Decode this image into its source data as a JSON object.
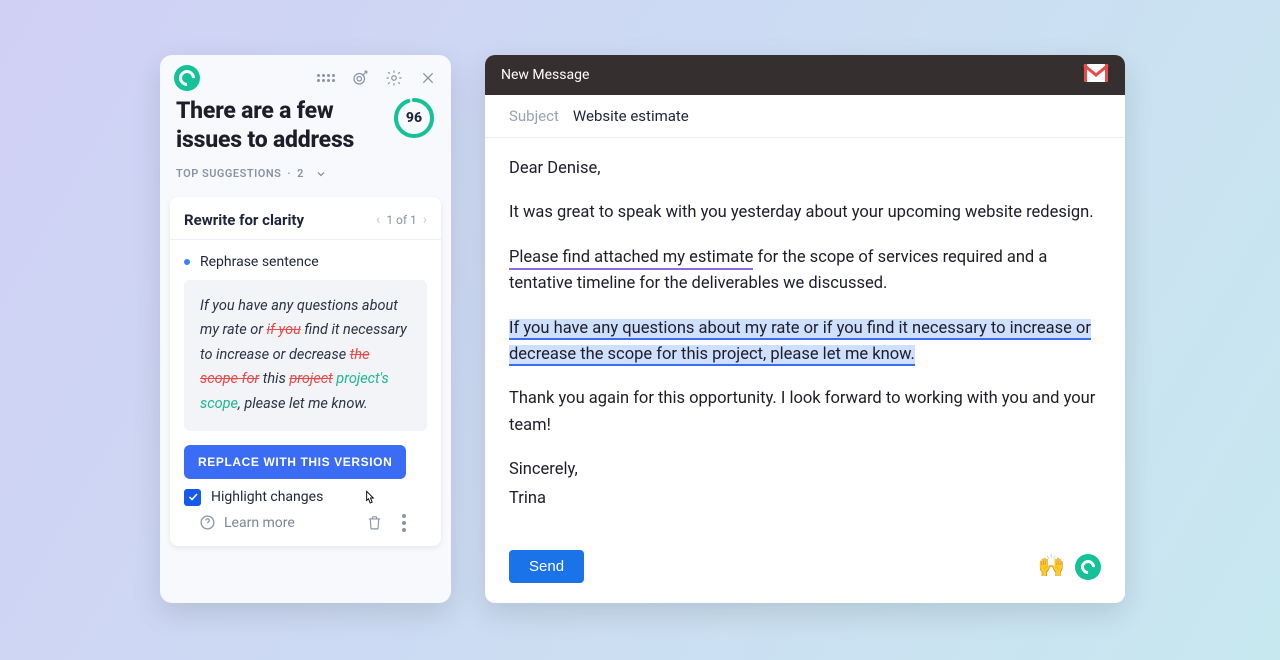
{
  "sidebar": {
    "title_line1": "There are a few",
    "title_line2": "issues to address",
    "score": "96",
    "top_suggestions_label": "TOP SUGGESTIONS",
    "top_suggestions_count": "2",
    "card": {
      "title": "Rewrite for clarity",
      "pager": "1 of 1",
      "bullet_label": "Rephrase sentence",
      "diff": {
        "p1": "If you have any questions about my rate or ",
        "d1": "if you",
        "p2": " find it necessary to increase or decrease ",
        "d2": "the scope for",
        "p3": " this ",
        "d3": "project",
        "i1": " project's scope",
        "p4": ", please let me know."
      },
      "replace_label": "REPLACE WITH THIS VERSION",
      "highlight_label": "Highlight changes",
      "highlight_checked": true,
      "learn_more": "Learn more"
    }
  },
  "email": {
    "window_title": "New Message",
    "subject_label": "Subject",
    "subject_value": "Website estimate",
    "body": {
      "greet": "Dear Denise,",
      "p1": "It was great to speak with you yesterday about your upcoming website redesign.",
      "p2a": "Please find attached my estimate",
      "p2b": " for the scope of services required and a tentative timeline for the deliverables we discussed.",
      "p3": "If you have any questions about my rate or if you find it necessary to increase or decrease the scope for this project, please let me know.",
      "p4": "Thank you again for this opportunity. I look forward to working with you and your team!",
      "closing": "Sincerely,",
      "name": "Trina"
    },
    "send": "Send",
    "emoji": "🙌"
  }
}
